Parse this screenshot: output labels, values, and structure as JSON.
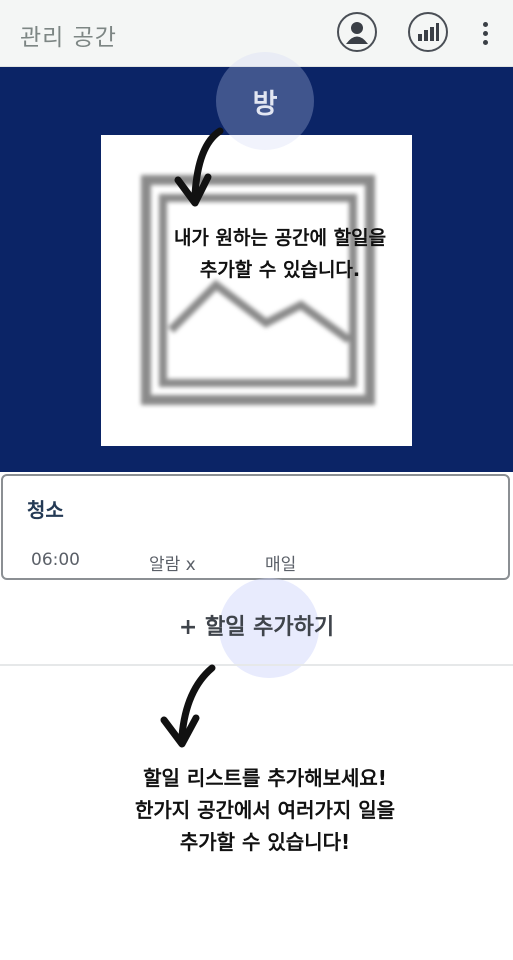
{
  "header": {
    "title": "관리 공간",
    "icons": [
      "profile-icon",
      "stats-icon",
      "more-vert-icon"
    ]
  },
  "room": {
    "label": "방",
    "image_icon": "image-placeholder-icon"
  },
  "todo": {
    "title": "청소",
    "time": "06:00",
    "alarm": "알람 x",
    "repeat": "매일"
  },
  "add_todo_label": "+ 할일 추가하기",
  "tutorial": {
    "tip1": [
      "내가 원하는 공간에 할일을",
      "추가할 수 있습니다."
    ],
    "tip2": [
      "할일 리스트를 추가해보세요!",
      "한가지 공간에서 여러가지 일을",
      "추가할 수 있습니다!"
    ]
  },
  "colors": {
    "room_background": "#0b2466",
    "header_background": "#f4f6f5",
    "halo": "#cdd4f5"
  }
}
